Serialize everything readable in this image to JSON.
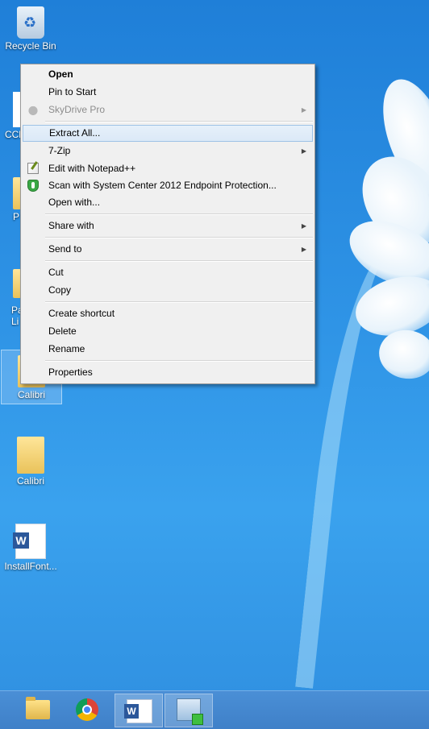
{
  "desktop": {
    "icons": [
      {
        "label": "Recycle Bin"
      },
      {
        "label": "CCl"
      },
      {
        "label": "P"
      },
      {
        "label": "Pa"
      },
      {
        "label": "Li"
      },
      {
        "label": "Calibri"
      },
      {
        "label": "Calibri"
      },
      {
        "label": "InstallFont..."
      }
    ]
  },
  "context_menu": {
    "items": [
      {
        "label": "Open"
      },
      {
        "label": "Pin to Start"
      },
      {
        "label": "SkyDrive Pro"
      },
      {
        "label": "Extract All..."
      },
      {
        "label": "7-Zip"
      },
      {
        "label": "Edit with Notepad++"
      },
      {
        "label": "Scan with System Center 2012 Endpoint Protection..."
      },
      {
        "label": "Open with..."
      },
      {
        "label": "Share with"
      },
      {
        "label": "Send to"
      },
      {
        "label": "Cut"
      },
      {
        "label": "Copy"
      },
      {
        "label": "Create shortcut"
      },
      {
        "label": "Delete"
      },
      {
        "label": "Rename"
      },
      {
        "label": "Properties"
      }
    ],
    "submenu_arrow": "▶"
  },
  "taskbar": {
    "apps": [
      {
        "icon": "file-explorer-icon"
      },
      {
        "icon": "chrome-icon"
      },
      {
        "icon": "word-icon"
      },
      {
        "icon": "remote-desktop-icon"
      }
    ]
  }
}
